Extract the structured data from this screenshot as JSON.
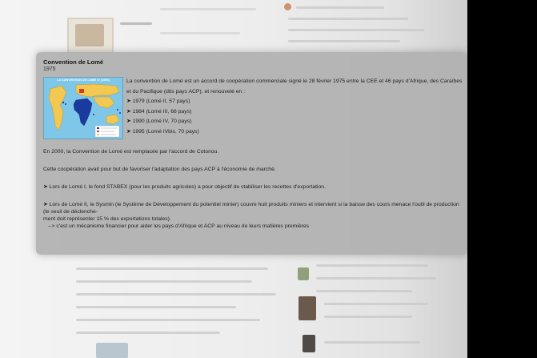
{
  "card": {
    "title": "Convention de Lomé",
    "year": "1975",
    "map_title": "LA CONVENTION DE LOMÉ IV (1990)",
    "intro": "La convention de Lomé est un accord de coopération commerciale signé le 28 février 1975 entre la CEE et 46 pays d'Afrique, des Caraïbes et du Pacifique (dits pays ACP), et renouvelé en :",
    "renewals": [
      "➤ 1979 (Lomé II, 57 pays)",
      "➤ 1984 (Lomé III, 66 pays)",
      "➤ 1990 (Lomé IV, 70 pays)",
      "➤ 1995 (Lomé IVbis, 70 pays)"
    ],
    "cotonou": "En 2000, la Convention de Lomé est remplacée par l'accord de Cotonou.",
    "purpose": "Cette coopération avait pour but de favoriser l'adaptation des pays ACP à l'économie de marché.",
    "stabex": "➤ Lors de Lomé I, le fond STABEX (pour les produits agricoles)  a pour objectif de stabiliser les recettes d'exportation.",
    "sysmin_1": "➤ Lors de Lomé II, le Sysmin (le Système de Développement du potentiel minier) couvre huit produits miniers et intervient si la baisse des cours menace l'outil de production (le seuil de déclenche-",
    "sysmin_2": "ment doit représenter 15 % des exportations totales).",
    "mechanism": "--> c'est un mécanisme financier pour aider les pays d'Afrique et ACP au  niveau de leurs matières premières"
  }
}
